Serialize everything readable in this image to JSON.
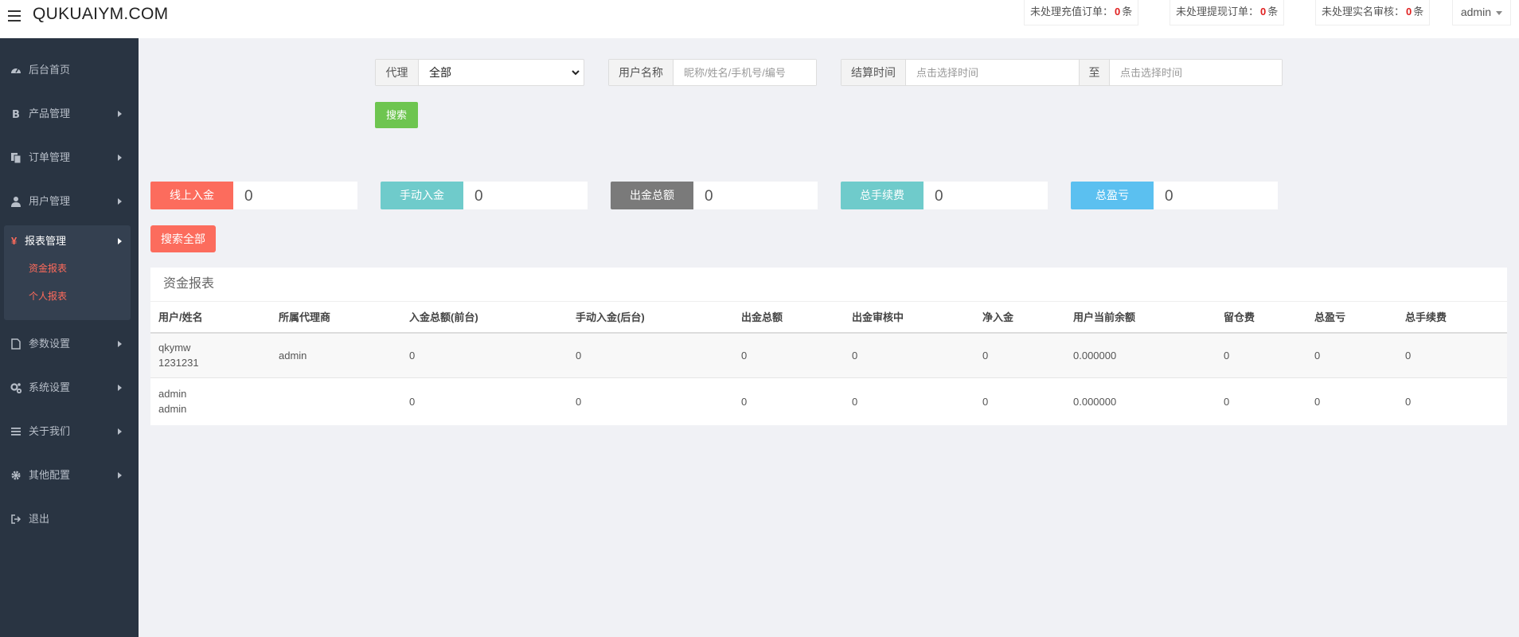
{
  "header": {
    "brand": "QUKUAIYM.COM",
    "notices": [
      {
        "label": "未处理充值订单：",
        "count": "0",
        "unit": "条"
      },
      {
        "label": "未处理提现订单：",
        "count": "0",
        "unit": "条"
      },
      {
        "label": "未处理实名审核：",
        "count": "0",
        "unit": "条"
      }
    ],
    "user": "admin"
  },
  "sidebar": {
    "items": [
      {
        "label": "后台首页",
        "icon": "dashboard-icon"
      },
      {
        "label": "产品管理",
        "icon": "bitcoin-icon"
      },
      {
        "label": "订单管理",
        "icon": "copy-icon"
      },
      {
        "label": "用户管理",
        "icon": "user-icon"
      },
      {
        "label": "报表管理",
        "icon": "yen-icon"
      },
      {
        "label": "参数设置",
        "icon": "file-icon"
      },
      {
        "label": "系统设置",
        "icon": "cogs-icon"
      },
      {
        "label": "关于我们",
        "icon": "list-icon"
      },
      {
        "label": "其他配置",
        "icon": "gear-icon"
      },
      {
        "label": "退出",
        "icon": "sign-out-icon"
      }
    ],
    "active_yen": "¥",
    "sub_items": [
      {
        "label": "资金报表"
      },
      {
        "label": "个人报表"
      }
    ]
  },
  "search": {
    "agent_label": "代理",
    "agent_selected": "全部",
    "username_label": "用户名称",
    "username_placeholder": "昵称/姓名/手机号/编号",
    "time_label": "结算时间",
    "time_start_placeholder": "点击选择时间",
    "time_sep": "至",
    "time_end_placeholder": "点击选择时间",
    "search_button": "搜索"
  },
  "stats": [
    {
      "label": "线上入金",
      "value": "0",
      "color": "#fc6c5d"
    },
    {
      "label": "手动入金",
      "value": "0",
      "color": "#6fcbcb"
    },
    {
      "label": "出金总额",
      "value": "0",
      "color": "#7a7a7a"
    },
    {
      "label": "总手续费",
      "value": "0",
      "color": "#6fcbcb"
    },
    {
      "label": "总盈亏",
      "value": "0",
      "color": "#5bc0f0"
    }
  ],
  "search_all_button": "搜索全部",
  "report": {
    "title": "资金报表",
    "columns": [
      "用户/姓名",
      "所属代理商",
      "入金总额(前台)",
      "手动入金(后台)",
      "出金总额",
      "出金审核中",
      "净入金",
      "用户当前余额",
      "留仓费",
      "总盈亏",
      "总手续费"
    ],
    "rows": [
      {
        "user": "qkymw",
        "name": "1231231",
        "agent": "admin",
        "deposit_front": "0",
        "deposit_manual": "0",
        "withdraw_total": "0",
        "withdraw_pending": "0",
        "net_deposit": "0",
        "balance": "0.000000",
        "storage_fee": "0",
        "pnl": "0",
        "fee": "0"
      },
      {
        "user": "admin",
        "name": "admin",
        "agent": "",
        "deposit_front": "0",
        "deposit_manual": "0",
        "withdraw_total": "0",
        "withdraw_pending": "0",
        "net_deposit": "0",
        "balance": "0.000000",
        "storage_fee": "0",
        "pnl": "0",
        "fee": "0"
      }
    ]
  }
}
